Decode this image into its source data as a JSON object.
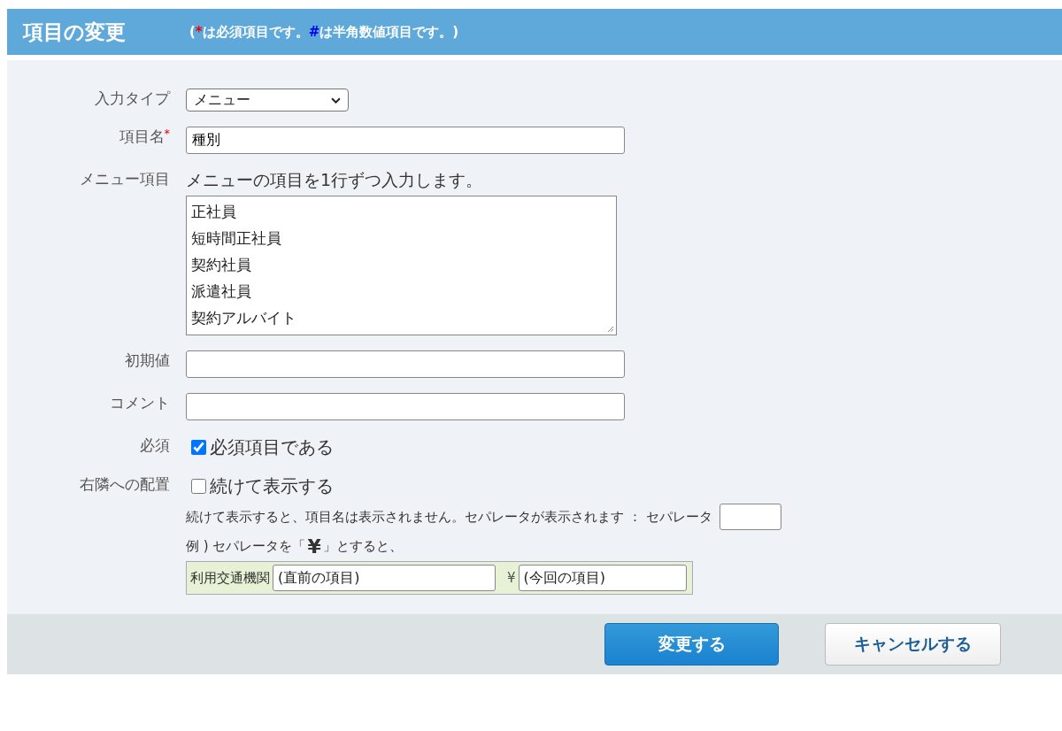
{
  "header": {
    "title": "項目の変更",
    "note": [
      {
        "kind": "text",
        "text": "("
      },
      {
        "kind": "required",
        "text": "*"
      },
      {
        "kind": "text",
        "text": "は必須項目です。"
      },
      {
        "kind": "numeric",
        "text": "#"
      },
      {
        "kind": "text",
        "text": "は半角数値項目です。)"
      }
    ]
  },
  "fields": [
    {
      "kind": "select",
      "label": "入力タイプ",
      "value": "メニュー"
    },
    {
      "kind": "input",
      "label": "項目名",
      "required_mark": "*",
      "value": "種別"
    },
    {
      "kind": "textarea",
      "label": "メニュー項目",
      "hint": "メニューの項目を1行ずつ入力します。",
      "items": [
        "正社員",
        "短時間正社員",
        "契約社員",
        "派遣社員",
        "契約アルバイト"
      ]
    },
    {
      "kind": "input",
      "label": "初期値"
    },
    {
      "kind": "input",
      "label": "コメント"
    },
    {
      "kind": "checkbox",
      "label": "必須",
      "option": "必須項目である",
      "checked": true
    },
    {
      "kind": "placement",
      "label": "右隣への配置",
      "option": "続けて表示する",
      "checked": false,
      "description": "続けて表示すると、項目名は表示されません。セパレータが表示されます ： セパレータ",
      "example_prefix": "例 ) セパレータを「",
      "example_symbol": "¥",
      "example_suffix": "」とすると、",
      "sample_label": "利用交通機関",
      "sample_previous": "(直前の項目)",
      "sample_separator": "¥",
      "sample_current": "(今回の項目)"
    }
  ],
  "buttons": [
    {
      "kind": "primary",
      "label": "変更する"
    },
    {
      "kind": "secondary",
      "label": "キャンセルする"
    }
  ]
}
